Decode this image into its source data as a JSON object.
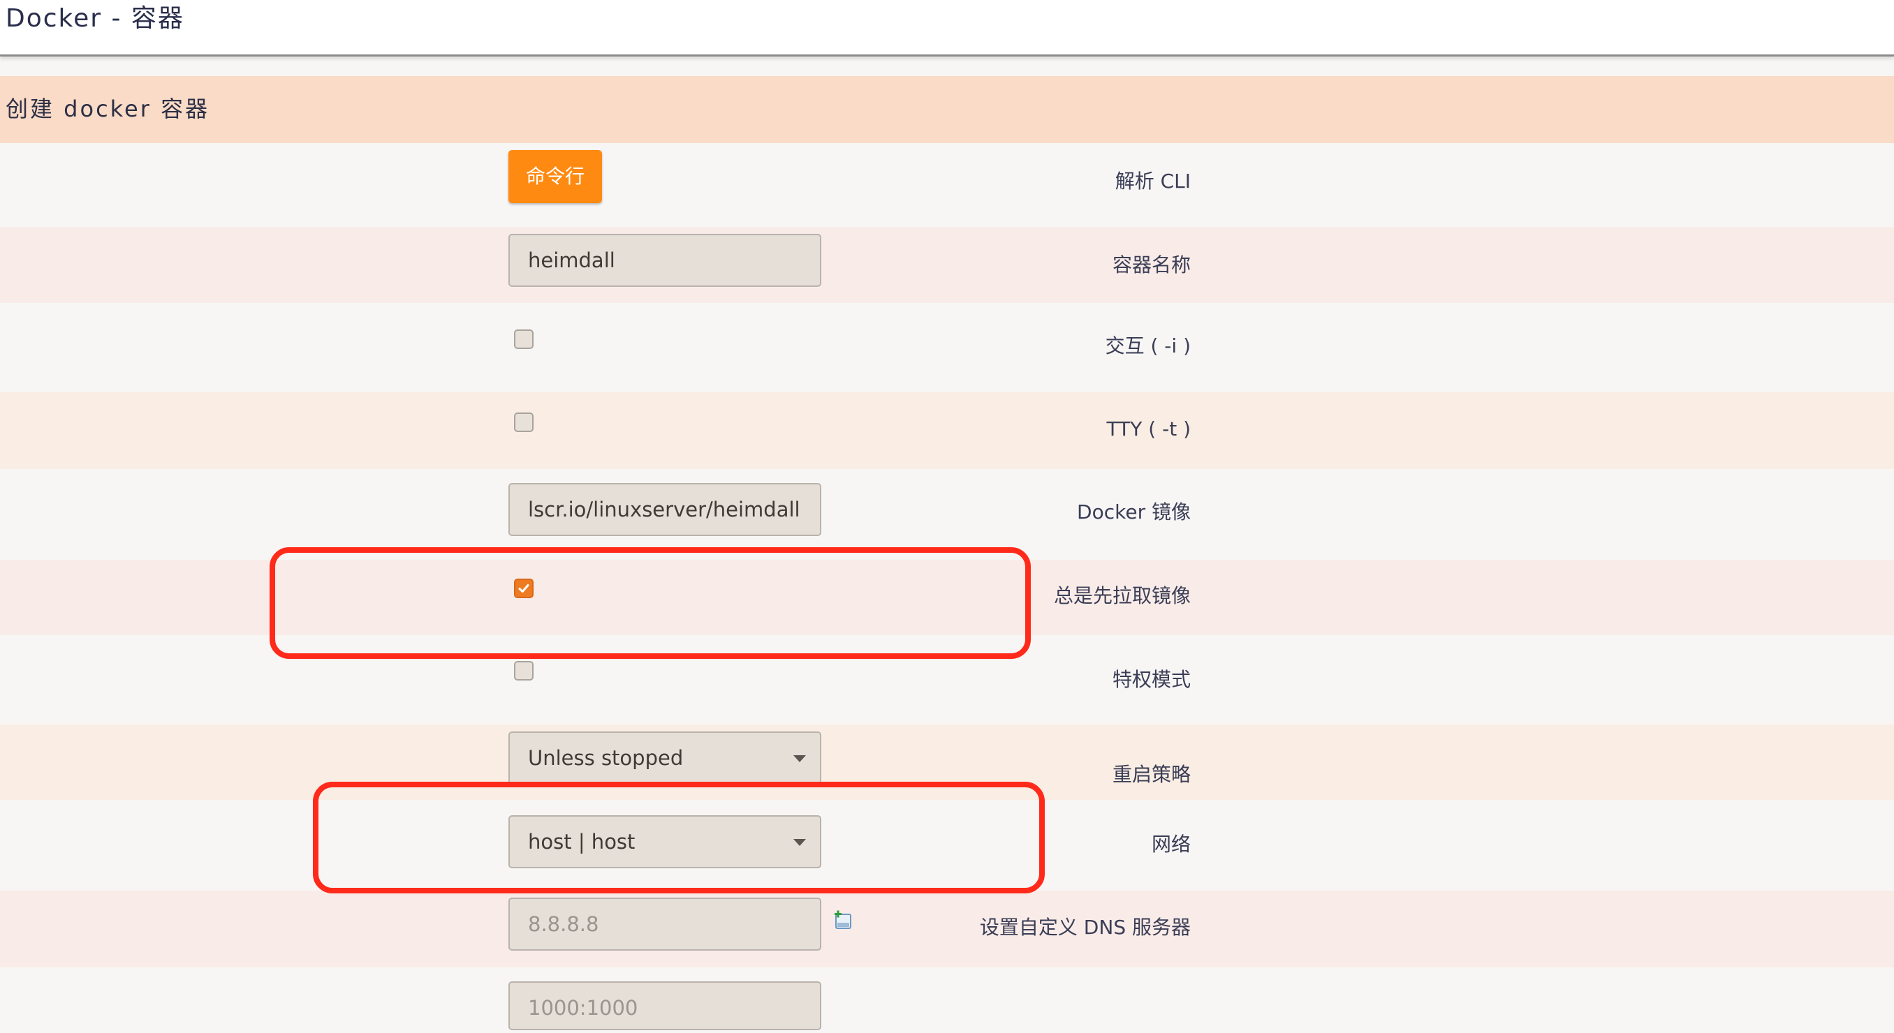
{
  "header": {
    "title": "Docker - 容器"
  },
  "section": {
    "title": "创建 docker 容器"
  },
  "form": {
    "cli": {
      "label": "解析 CLI",
      "button_label": "命令行"
    },
    "container_name": {
      "label": "容器名称",
      "value": "heimdall"
    },
    "interactive": {
      "label": "交互 ( -i )",
      "checked": false
    },
    "tty": {
      "label": "TTY ( -t )",
      "checked": false
    },
    "image": {
      "label": "Docker 镜像",
      "value": "lscr.io/linuxserver/heimdall"
    },
    "always_pull": {
      "label": "总是先拉取镜像",
      "checked": true
    },
    "privileged": {
      "label": "特权模式",
      "checked": false
    },
    "restart_policy": {
      "label": "重启策略",
      "value": "Unless stopped"
    },
    "network": {
      "label": "网络",
      "value": "host | host"
    },
    "dns": {
      "label": "设置自定义 DNS 服务器",
      "placeholder": "8.8.8.8",
      "add_icon": "add-entry-icon"
    },
    "next_field": {
      "placeholder": "1000:1000"
    }
  },
  "colors": {
    "accent": "#ff8a12",
    "section_header": "#f9dbc7",
    "highlight": "#ff2a1a",
    "checkbox_checked": "#ee7b22"
  }
}
